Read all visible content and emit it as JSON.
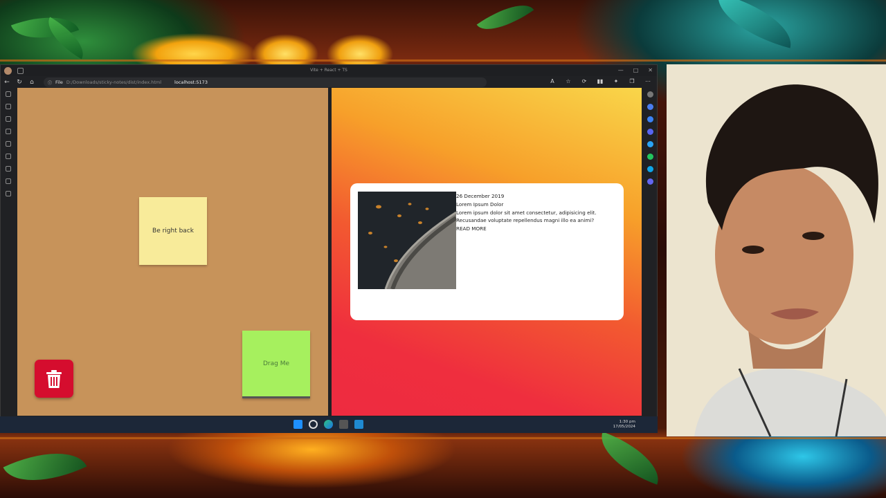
{
  "browser": {
    "window_title": "Vite + React + TS",
    "address": {
      "file_label": "File",
      "file_path": "D:/Downloads/sticky-notes/dist/index.html",
      "localhost": "localhost:5173"
    },
    "window_controls": [
      "—",
      "□",
      "✕"
    ]
  },
  "sticky_notes_app": {
    "background": "#c7935a",
    "notes": [
      {
        "text": "Be right back",
        "color": "#f8eb9a"
      },
      {
        "text": "Drag Me",
        "color": "#a6f05e"
      }
    ],
    "trash_icon": "trash-icon",
    "trash_color": "#d50d2e"
  },
  "blog_card_app": {
    "card": {
      "date": "26 December 2019",
      "title": "Lorem Ipsum Dolor",
      "body": "Lorem ipsum dolor sit amet consectetur, adipisicing elit. Recusandae voluptate repellendus magni illo ea animi?",
      "read_more": "READ MORE",
      "image": "leaves-on-pavement-photo"
    },
    "gradient": [
      "#f9d64a",
      "#f25a30",
      "#ee2b40"
    ]
  },
  "taskbar": {
    "time": "1:30 pm",
    "date": "17/05/2024",
    "apps": [
      "windows-start-icon",
      "search-icon",
      "edge-icon",
      "task-view-icon",
      "vscode-icon"
    ]
  },
  "webcam": {
    "subject": "presenter-webcam"
  }
}
